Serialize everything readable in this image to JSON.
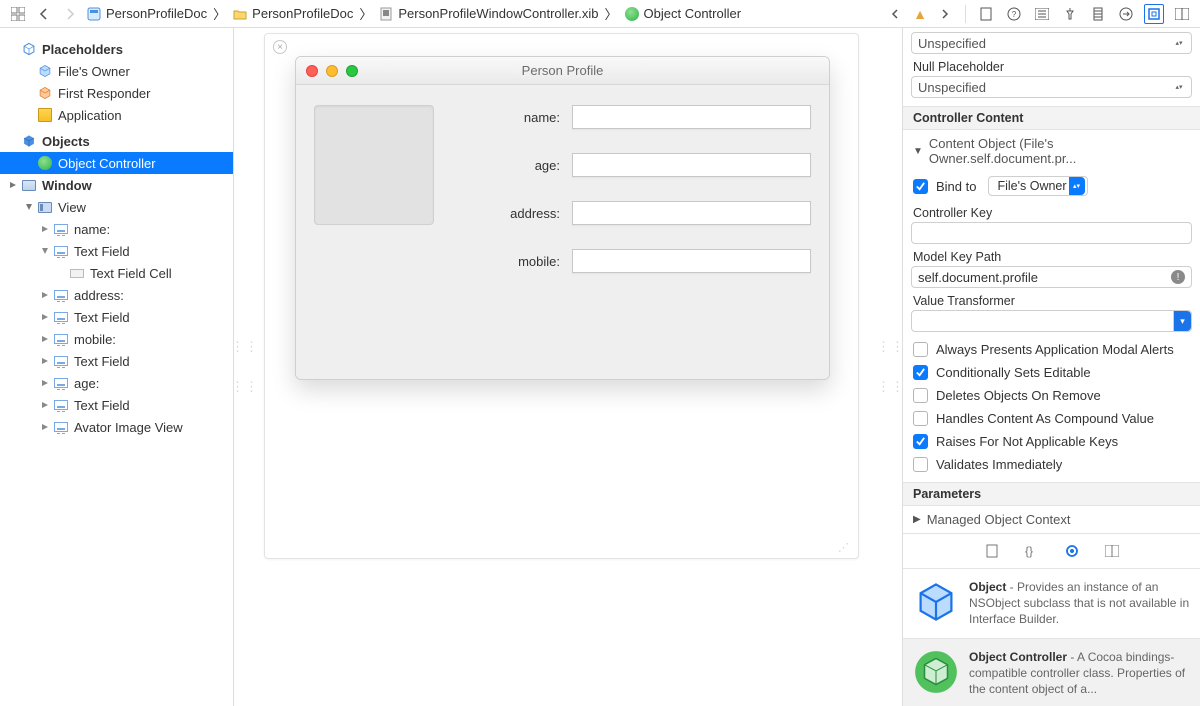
{
  "breadcrumbs": {
    "project": "PersonProfileDoc",
    "folder": "PersonProfileDoc",
    "file": "PersonProfileWindowController.xib",
    "object": "Object Controller"
  },
  "outline": {
    "placeholders_header": "Placeholders",
    "files_owner": "File's Owner",
    "first_responder": "First Responder",
    "application": "Application",
    "objects_header": "Objects",
    "object_controller": "Object Controller",
    "window": "Window",
    "view": "View",
    "items": {
      "name": "name:",
      "tf1": "Text Field",
      "tfc": "Text Field Cell",
      "address": "address:",
      "tf2": "Text Field",
      "mobile": "mobile:",
      "tf3": "Text Field",
      "age": "age:",
      "tf4": "Text Field",
      "avatar": "Avator Image View"
    }
  },
  "window": {
    "title": "Person Profile",
    "fields": {
      "name": "name:",
      "age": "age:",
      "address": "address:",
      "mobile": "mobile:"
    }
  },
  "inspector": {
    "unspecified": "Unspecified",
    "null_placeholder_label": "Null Placeholder",
    "controller_content_header": "Controller Content",
    "content_object_label": "Content Object (File's Owner.self.document.pr...",
    "bind_to": "Bind to",
    "bind_target": "File's Owner",
    "controller_key_label": "Controller Key",
    "model_key_path_label": "Model Key Path",
    "model_key_path_value": "self.document.profile",
    "value_transformer_label": "Value Transformer",
    "opt_always": "Always Presents Application Modal Alerts",
    "opt_cond": "Conditionally Sets Editable",
    "opt_del": "Deletes Objects On Remove",
    "opt_compound": "Handles Content As Compound Value",
    "opt_raises": "Raises For Not Applicable Keys",
    "opt_validates": "Validates Immediately",
    "parameters_header": "Parameters",
    "moc": "Managed Object Context"
  },
  "library": {
    "object_title": "Object",
    "object_desc": " - Provides an instance of an NSObject subclass that is not available in Interface Builder.",
    "oc_title": "Object Controller",
    "oc_desc": " - A Cocoa bindings-compatible controller class. Properties of the content object of a..."
  }
}
